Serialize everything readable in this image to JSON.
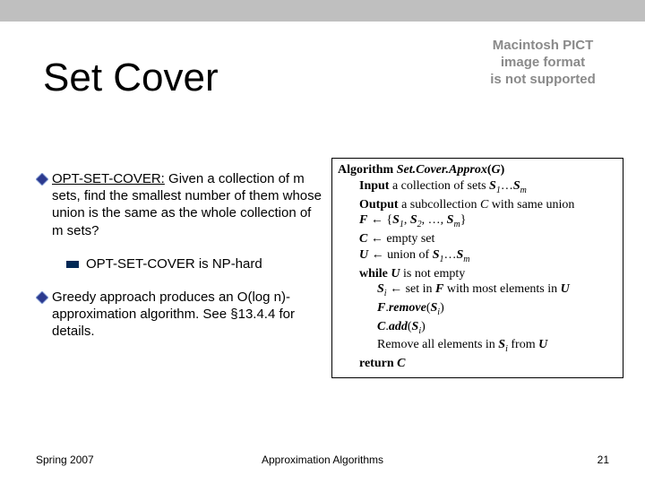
{
  "title": "Set Cover",
  "pict_placeholder": {
    "l1": "Macintosh PICT",
    "l2": "image format",
    "l3": "is not supported"
  },
  "left": {
    "bullet1_lead": "OPT-SET-COVER:",
    "bullet1_rest": " Given a collection of m sets, find the smallest number of them whose union is the same as the whole collection of m sets?",
    "bullet1_sub": "OPT-SET-COVER is NP-hard",
    "bullet2": "Greedy approach produces an O(log n)-approximation algorithm. See §13.4.4 for details."
  },
  "algo": {
    "l0a": "Algorithm ",
    "l0b": "Set.Cover.Approx",
    "l0c": "(",
    "l0d": "G",
    "l0e": ")",
    "l1a": "Input",
    "l1b": " a collection of sets ",
    "l1c": "S",
    "l1d": "1",
    "l1e": "…",
    "l1f": "S",
    "l1g": "m",
    "l2a": "Output",
    "l2b": " a subcollection ",
    "l2c": "C",
    "l2d": " with same union",
    "l3a": "F",
    "l3b": " ← {",
    "l3c": "S",
    "l3d": "1",
    "l3e": ", ",
    "l3f": "S",
    "l3g": "2",
    "l3h": ", …, ",
    "l3i": "S",
    "l3j": "m",
    "l3k": "}",
    "l4a": "C",
    "l4b": " ← empty set",
    "l5a": "U",
    "l5b": " ← union of ",
    "l5c": "S",
    "l5d": "1",
    "l5e": "…",
    "l5f": "S",
    "l5g": "m",
    "l6a": "while ",
    "l6b": "U",
    "l6c": " is not empty",
    "l7a": "S",
    "l7b": "i",
    "l7c": " ← set in ",
    "l7d": "F",
    "l7e": " with most elements in ",
    "l7f": "U",
    "l8a": "F",
    "l8b": ".",
    "l8c": "remove",
    "l8d": "(",
    "l8e": "S",
    "l8f": "i",
    "l8g": ")",
    "l9a": "C",
    "l9b": ".",
    "l9c": "add",
    "l9d": "(",
    "l9e": "S",
    "l9f": "i",
    "l9g": ")",
    "l10a": "Remove all elements in ",
    "l10b": "S",
    "l10c": "i",
    "l10d": " from ",
    "l10e": "U",
    "l11a": "return ",
    "l11b": "C"
  },
  "footer": {
    "left": "Spring 2007",
    "center": "Approximation Algorithms",
    "right": "21"
  }
}
